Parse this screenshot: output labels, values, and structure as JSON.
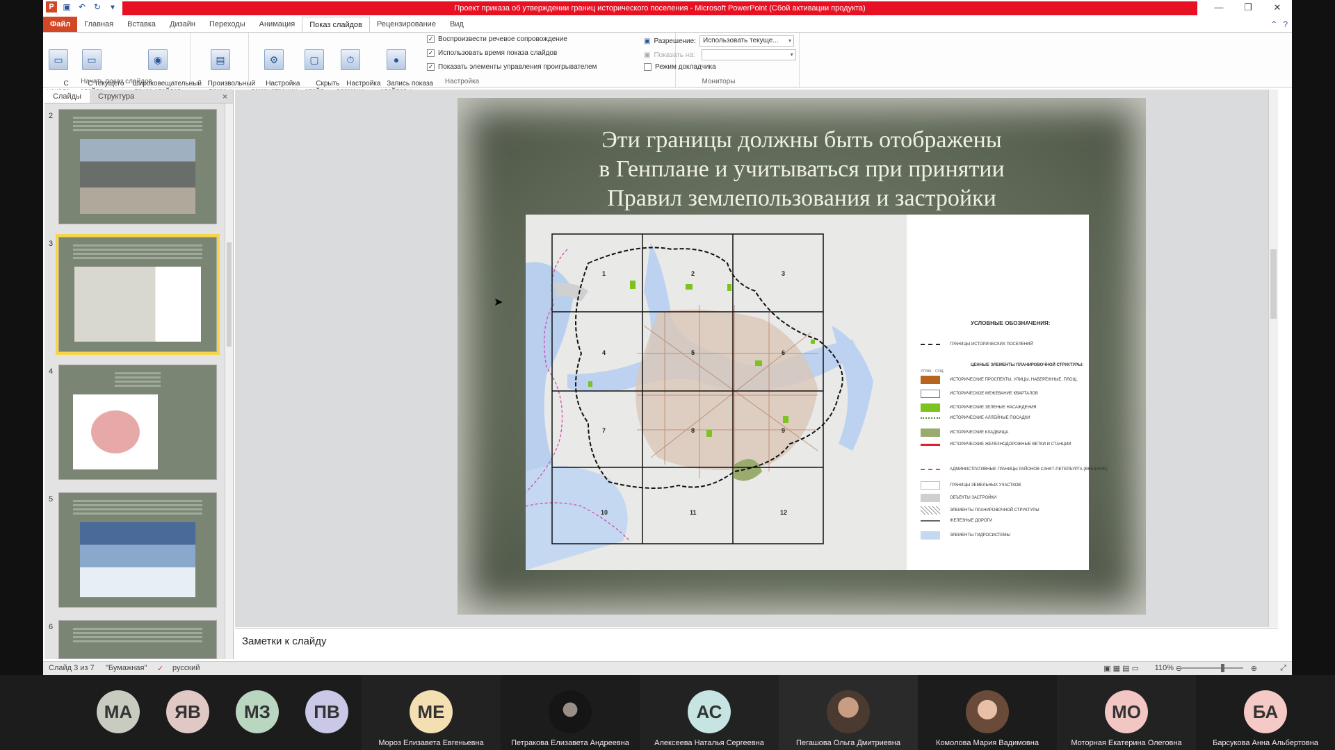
{
  "window": {
    "title": "Проект приказа об утверждении границ исторического поселения - Microsoft PowerPoint (Сбой активации продукта)"
  },
  "tabs": [
    {
      "label": "Файл"
    },
    {
      "label": "Главная"
    },
    {
      "label": "Вставка"
    },
    {
      "label": "Дизайн"
    },
    {
      "label": "Переходы"
    },
    {
      "label": "Анимация"
    },
    {
      "label": "Показ слайдов"
    },
    {
      "label": "Рецензирование"
    },
    {
      "label": "Вид"
    }
  ],
  "ribbon": {
    "group_start": {
      "label": "Начать показ слайдов",
      "buttons": [
        {
          "label": "С\nначала"
        },
        {
          "label": "С текущего\nслайда"
        },
        {
          "label": "Широковещательный\nпоказ слайдов"
        },
        {
          "label": "Произвольный\nпоказ ▾"
        }
      ]
    },
    "group_setup": {
      "label": "Настройка",
      "buttons": [
        {
          "label": "Настройка\nдемонстрации"
        },
        {
          "label": "Скрыть\nслайд"
        },
        {
          "label": "Настройка\nвремени"
        },
        {
          "label": "Запись показа\nслайдов ▾"
        }
      ],
      "checks": [
        {
          "label": "Воспроизвести речевое сопровождение",
          "checked": "✓"
        },
        {
          "label": "Использовать время показа слайдов",
          "checked": "✓"
        },
        {
          "label": "Показать элементы управления проигрывателем",
          "checked": "✓"
        }
      ]
    },
    "group_monitors": {
      "label": "Мониторы",
      "resolution_label": "Разрешение:",
      "resolution_value": "Использовать текуще...",
      "show_on_label": "Показать на:",
      "show_on_value": "",
      "presenter_label": "Режим докладчика"
    }
  },
  "left_pane": {
    "tab_slides": "Слайды",
    "tab_outline": "Структура",
    "close": "×",
    "thumbnails": [
      {
        "number": "2"
      },
      {
        "number": "3"
      },
      {
        "number": "4"
      },
      {
        "number": "5"
      },
      {
        "number": "6"
      }
    ]
  },
  "slide": {
    "title_lines": [
      "Эти границы должны быть отображены",
      "в Генплане и учитываться при принятии",
      "Правил землепользования и застройки"
    ],
    "map_cells": [
      "1",
      "2",
      "3",
      "4",
      "5",
      "6",
      "7",
      "8",
      "9",
      "10",
      "11",
      "12"
    ],
    "legend": {
      "title": "УСЛОВНЫЕ ОБОЗНАЧЕНИЯ:",
      "section_head": "ЦЕННЫЕ ЭЛЕМЕНТЫ ПЛАНИРОВОЧНОЙ СТРУКТУРЫ:",
      "col_a": "УТРАЧ.",
      "col_b": "СУЩ.",
      "items": [
        {
          "label": "ГРАНИЦЫ ИСТОРИЧЕСКИХ ПОСЕЛЕНИЙ",
          "color": "#222222"
        },
        {
          "label": "ИСТОРИЧЕСКИЕ ПРОСПЕКТЫ, УЛИЦЫ, НАБЕРЕЖНЫЕ, ПЛОЩ.",
          "color": "#b5651d"
        },
        {
          "label": "ИСТОРИЧЕСКОЕ МЕЖЕВАНИЕ КВАРТАЛОВ",
          "color": "#6b7fa8"
        },
        {
          "label": "ИСТОРИЧЕСКИЕ ЗЕЛЕНЫЕ НАСАЖДЕНИЯ",
          "color": "#7ec21e"
        },
        {
          "label": "ИСТОРИЧЕСКИЕ АЛЛЕЙНЫЕ ПОСАДКИ",
          "color": "#5a8a2a"
        },
        {
          "label": "ИСТОРИЧЕСКИЕ КЛАДБИЩА",
          "color": "#9aab6e"
        },
        {
          "label": "ИСТОРИЧЕСКИЕ ЖЕЛЕЗНОДОРОЖНЫЕ ВЕТКИ И СТАНЦИИ",
          "color": "#d8232a"
        },
        {
          "label": "АДМИНИСТРАТИВНЫЕ ГРАНИЦЫ РАЙОНОВ САНКТ-ПЕТЕРБУРГА (ВНЕШНИЕ)",
          "color": "#d63caa"
        },
        {
          "label": "ГРАНИЦЫ ЗЕМЕЛЬНЫХ УЧАСТКОВ",
          "color": "#bbbbbb"
        },
        {
          "label": "ОБЪЕКТЫ ЗАСТРОЙКИ",
          "color": "#cfcfcf"
        },
        {
          "label": "ЭЛЕМЕНТЫ ПЛАНИРОВОЧНОЙ СТРУКТУРЫ",
          "color": "#999999"
        },
        {
          "label": "ЖЕЛЕЗНЫЕ ДОРОГИ",
          "color": "#666666"
        },
        {
          "label": "ЭЛЕМЕНТЫ ГИДРОСИСТЕМЫ",
          "color": "#c5d8f2"
        }
      ]
    }
  },
  "notes": {
    "placeholder": "Заметки к слайду"
  },
  "status": {
    "slide_info": "Слайд 3 из 7",
    "theme": "\"Бумажная\"",
    "language": "русский",
    "zoom": "110%"
  },
  "participants": [
    {
      "initials": "МА",
      "name": "",
      "color": "#c8ccc0"
    },
    {
      "initials": "ЯВ",
      "name": "",
      "color": "#e0c9c5"
    },
    {
      "initials": "МЗ",
      "name": "",
      "color": "#b9d6c1"
    },
    {
      "initials": "ПВ",
      "name": "",
      "color": "#c9c8e6"
    },
    {
      "initials": "МЕ",
      "name": "Мороз Елизавета Евгеньевна",
      "color": "#f3dfb2"
    },
    {
      "initials": "",
      "name": "Петракова Елизавета Андреевна",
      "color": ""
    },
    {
      "initials": "АС",
      "name": "Алексеева Наталья Сергеевна",
      "color": "#c5e4e2"
    },
    {
      "initials": "",
      "name": "Пегашова Ольга Дмитриевна",
      "color": ""
    },
    {
      "initials": "",
      "name": "Комолова Мария Вадимовна",
      "color": ""
    },
    {
      "initials": "МО",
      "name": "Моторная Екатерина Олеговна",
      "color": "#f2c6c2"
    },
    {
      "initials": "БА",
      "name": "Барсукова Анна Альбертовна",
      "color": "#f5c9c5"
    }
  ]
}
